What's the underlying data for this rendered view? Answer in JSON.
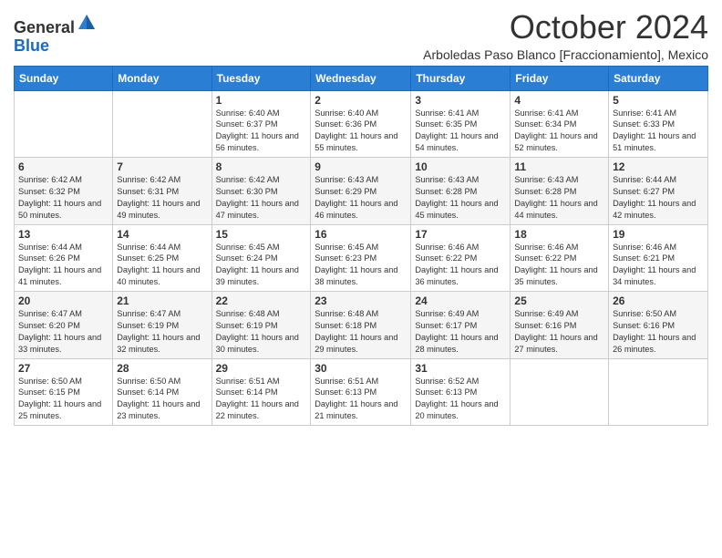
{
  "header": {
    "logo": {
      "text_general": "General",
      "text_blue": "Blue"
    },
    "month_title": "October 2024",
    "location": "Arboledas Paso Blanco [Fraccionamiento], Mexico"
  },
  "days_of_week": [
    "Sunday",
    "Monday",
    "Tuesday",
    "Wednesday",
    "Thursday",
    "Friday",
    "Saturday"
  ],
  "weeks": [
    {
      "days": [
        {
          "number": "",
          "info": ""
        },
        {
          "number": "",
          "info": ""
        },
        {
          "number": "1",
          "info": "Sunrise: 6:40 AM\nSunset: 6:37 PM\nDaylight: 11 hours and 56 minutes."
        },
        {
          "number": "2",
          "info": "Sunrise: 6:40 AM\nSunset: 6:36 PM\nDaylight: 11 hours and 55 minutes."
        },
        {
          "number": "3",
          "info": "Sunrise: 6:41 AM\nSunset: 6:35 PM\nDaylight: 11 hours and 54 minutes."
        },
        {
          "number": "4",
          "info": "Sunrise: 6:41 AM\nSunset: 6:34 PM\nDaylight: 11 hours and 52 minutes."
        },
        {
          "number": "5",
          "info": "Sunrise: 6:41 AM\nSunset: 6:33 PM\nDaylight: 11 hours and 51 minutes."
        }
      ]
    },
    {
      "days": [
        {
          "number": "6",
          "info": "Sunrise: 6:42 AM\nSunset: 6:32 PM\nDaylight: 11 hours and 50 minutes."
        },
        {
          "number": "7",
          "info": "Sunrise: 6:42 AM\nSunset: 6:31 PM\nDaylight: 11 hours and 49 minutes."
        },
        {
          "number": "8",
          "info": "Sunrise: 6:42 AM\nSunset: 6:30 PM\nDaylight: 11 hours and 47 minutes."
        },
        {
          "number": "9",
          "info": "Sunrise: 6:43 AM\nSunset: 6:29 PM\nDaylight: 11 hours and 46 minutes."
        },
        {
          "number": "10",
          "info": "Sunrise: 6:43 AM\nSunset: 6:28 PM\nDaylight: 11 hours and 45 minutes."
        },
        {
          "number": "11",
          "info": "Sunrise: 6:43 AM\nSunset: 6:28 PM\nDaylight: 11 hours and 44 minutes."
        },
        {
          "number": "12",
          "info": "Sunrise: 6:44 AM\nSunset: 6:27 PM\nDaylight: 11 hours and 42 minutes."
        }
      ]
    },
    {
      "days": [
        {
          "number": "13",
          "info": "Sunrise: 6:44 AM\nSunset: 6:26 PM\nDaylight: 11 hours and 41 minutes."
        },
        {
          "number": "14",
          "info": "Sunrise: 6:44 AM\nSunset: 6:25 PM\nDaylight: 11 hours and 40 minutes."
        },
        {
          "number": "15",
          "info": "Sunrise: 6:45 AM\nSunset: 6:24 PM\nDaylight: 11 hours and 39 minutes."
        },
        {
          "number": "16",
          "info": "Sunrise: 6:45 AM\nSunset: 6:23 PM\nDaylight: 11 hours and 38 minutes."
        },
        {
          "number": "17",
          "info": "Sunrise: 6:46 AM\nSunset: 6:22 PM\nDaylight: 11 hours and 36 minutes."
        },
        {
          "number": "18",
          "info": "Sunrise: 6:46 AM\nSunset: 6:22 PM\nDaylight: 11 hours and 35 minutes."
        },
        {
          "number": "19",
          "info": "Sunrise: 6:46 AM\nSunset: 6:21 PM\nDaylight: 11 hours and 34 minutes."
        }
      ]
    },
    {
      "days": [
        {
          "number": "20",
          "info": "Sunrise: 6:47 AM\nSunset: 6:20 PM\nDaylight: 11 hours and 33 minutes."
        },
        {
          "number": "21",
          "info": "Sunrise: 6:47 AM\nSunset: 6:19 PM\nDaylight: 11 hours and 32 minutes."
        },
        {
          "number": "22",
          "info": "Sunrise: 6:48 AM\nSunset: 6:19 PM\nDaylight: 11 hours and 30 minutes."
        },
        {
          "number": "23",
          "info": "Sunrise: 6:48 AM\nSunset: 6:18 PM\nDaylight: 11 hours and 29 minutes."
        },
        {
          "number": "24",
          "info": "Sunrise: 6:49 AM\nSunset: 6:17 PM\nDaylight: 11 hours and 28 minutes."
        },
        {
          "number": "25",
          "info": "Sunrise: 6:49 AM\nSunset: 6:16 PM\nDaylight: 11 hours and 27 minutes."
        },
        {
          "number": "26",
          "info": "Sunrise: 6:50 AM\nSunset: 6:16 PM\nDaylight: 11 hours and 26 minutes."
        }
      ]
    },
    {
      "days": [
        {
          "number": "27",
          "info": "Sunrise: 6:50 AM\nSunset: 6:15 PM\nDaylight: 11 hours and 25 minutes."
        },
        {
          "number": "28",
          "info": "Sunrise: 6:50 AM\nSunset: 6:14 PM\nDaylight: 11 hours and 23 minutes."
        },
        {
          "number": "29",
          "info": "Sunrise: 6:51 AM\nSunset: 6:14 PM\nDaylight: 11 hours and 22 minutes."
        },
        {
          "number": "30",
          "info": "Sunrise: 6:51 AM\nSunset: 6:13 PM\nDaylight: 11 hours and 21 minutes."
        },
        {
          "number": "31",
          "info": "Sunrise: 6:52 AM\nSunset: 6:13 PM\nDaylight: 11 hours and 20 minutes."
        },
        {
          "number": "",
          "info": ""
        },
        {
          "number": "",
          "info": ""
        }
      ]
    }
  ]
}
